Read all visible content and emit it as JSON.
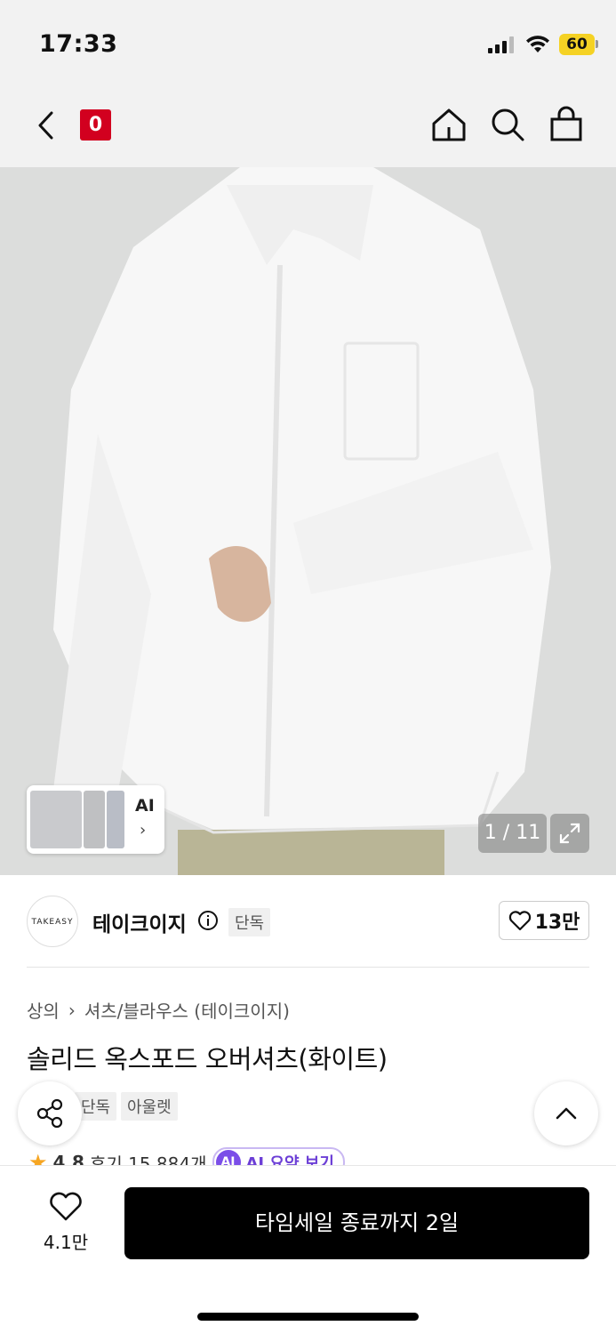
{
  "status_bar": {
    "time": "17:33",
    "battery": "60"
  },
  "nav": {
    "logo_text": "0"
  },
  "hero": {
    "thumb_label": "AI",
    "counter": "1 / 11"
  },
  "brand": {
    "logo_text": "TAKEASY",
    "name": "테이크이지",
    "tag": "단독",
    "likes": "13만"
  },
  "product": {
    "breadcrumb_category": "상의",
    "breadcrumb_sub": "셔츠/블라우스 (테이크이지)",
    "title": "솔리드 옥스포드 오버셔츠(화이트)",
    "tags": [
      "단독",
      "아울렛"
    ],
    "rating": "4.8",
    "reviews": "후기 15,884개",
    "ai_badge": "AI",
    "ai_summary": "AI 요약 보기"
  },
  "bottom_bar": {
    "like_count": "4.1만",
    "cta": "타임세일 종료까지 2일"
  }
}
